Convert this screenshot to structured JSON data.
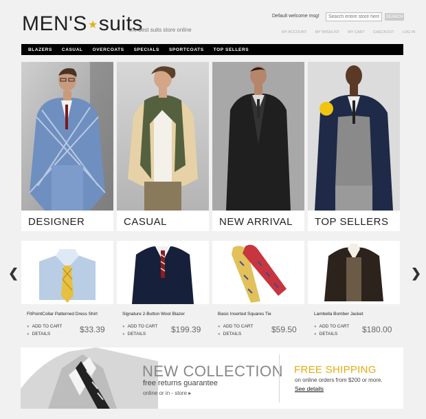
{
  "header": {
    "logo_left": "MEN'S",
    "logo_right": "suits",
    "tagline": "the best suits store online",
    "welcome": "Default welcome msg!",
    "search_placeholder": "Search entire store here...",
    "search_button": "SEARCH",
    "links": [
      "MY ACCOUNT",
      "MY WISHLIST",
      "MY CART",
      "CHECKOUT",
      "LOG IN"
    ]
  },
  "nav": [
    "BLAZERS",
    "CASUAL",
    "OVERCOATS",
    "SPECIALS",
    "SPORTCOATS",
    "TOP SELLERS"
  ],
  "categories": [
    "DESIGNER",
    "CASUAL",
    "NEW ARRIVAL",
    "TOP SELLERS"
  ],
  "products": [
    {
      "name": "FitPointCollar Patterned Dress Shirt",
      "add": "ADD TO CART",
      "details": "DETAILS",
      "price": "$33.39"
    },
    {
      "name": "Signature 2-Button Wool Blazer",
      "add": "ADD TO CART",
      "details": "DETAILS",
      "price": "$199.39"
    },
    {
      "name": "Basic Inserted Squares Tie",
      "add": "ADD TO CART",
      "details": "DETAILS",
      "price": "$59.50"
    },
    {
      "name": "Lambella Bomber Jacket",
      "add": "ADD TO CART",
      "details": "DETAILS",
      "price": "$180.00"
    }
  ],
  "carousel": {
    "prev": "❮",
    "next": "❯"
  },
  "banner": {
    "title": "NEW COLLECTION",
    "subtitle": "free returns guarantee",
    "link": "online or in - store ▸",
    "shipping_title": "FREE SHIPPING",
    "shipping_sub": "on online orders from $200 or more.",
    "shipping_link": "See details"
  },
  "colors": {
    "accent": "#e8a90e",
    "nav_bg": "#000000",
    "page_bg": "#f1f1f1"
  }
}
